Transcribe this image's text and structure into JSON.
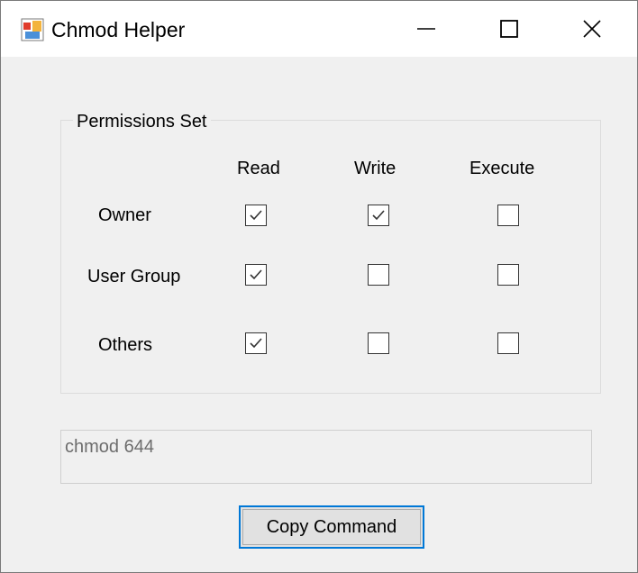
{
  "window": {
    "title": "Chmod Helper",
    "icon": "app-icon",
    "controls": [
      "minimize-icon",
      "maximize-icon",
      "close-icon"
    ]
  },
  "permissions": {
    "group_label": "Permissions Set",
    "columns": [
      "Read",
      "Write",
      "Execute"
    ],
    "rows": [
      {
        "label": "Owner",
        "read": true,
        "write": true,
        "execute": false
      },
      {
        "label": "User Group",
        "read": true,
        "write": false,
        "execute": false
      },
      {
        "label": "Others",
        "read": true,
        "write": false,
        "execute": false
      }
    ]
  },
  "output": {
    "command": "chmod 644"
  },
  "copy_button": {
    "label": "Copy Command"
  },
  "colors": {
    "accent": "#0078d7",
    "window_bg": "#f0f0f0",
    "titlebar_bg": "#ffffff",
    "output_text": "#6d6d6d"
  }
}
